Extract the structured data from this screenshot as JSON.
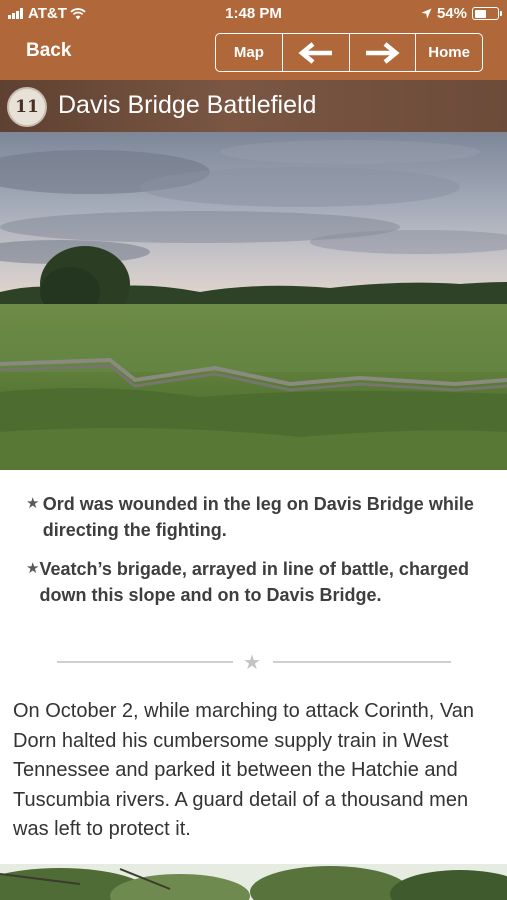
{
  "status_bar": {
    "carrier": "AT&T",
    "time": "1:48 PM",
    "battery_percent": "54%",
    "battery_level": 0.54,
    "icons": [
      "signal-icon",
      "wifi-icon",
      "location-icon",
      "battery-icon"
    ]
  },
  "nav": {
    "back_label": "Back",
    "map_label": "Map",
    "prev_icon": "arrow-left-icon",
    "next_icon": "arrow-right-icon",
    "home_label": "Home"
  },
  "header": {
    "stop_number": "11",
    "title": "Davis Bridge Battlefield"
  },
  "bullets": [
    "Ord was wounded in the leg on Davis Bridge while directing the fighting.",
    "Veatch’s brigade, arrayed in line of battle, charged down this slope and on to Davis Bridge."
  ],
  "bullet_marker": "★",
  "divider_marker": "★",
  "body_text": "On October 2, while marching to attack Corinth, Van Dorn halted his cumbersome supply train in West Tennessee and parked it between the Hatchie and Tuscumbia rivers. A guard detail of a thousand men was left to protect it.",
  "colors": {
    "nav_bar": "#b0683a",
    "title_bar": "#6d4b3a",
    "text": "#333333"
  }
}
